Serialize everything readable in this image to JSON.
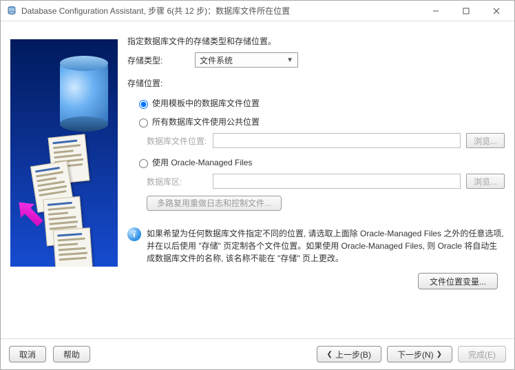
{
  "title": "Database Configuration Assistant, 步骤 6(共 12 步)：数据库文件所在位置",
  "header": "指定数据库文件的存储类型和存储位置。",
  "storage_type_label": "存储类型:",
  "storage_type_value": "文件系统",
  "storage_loc_label": "存储位置:",
  "radios": {
    "template": "使用模板中的数据库文件位置",
    "common": "所有数据库文件使用公共位置",
    "common_field_label": "数据库文件位置:",
    "omf": "使用 Oracle-Managed Files",
    "omf_field_label": "数据库区:"
  },
  "browse_label": "浏览...",
  "multiplex_btn": "多路复用重做日志和控制文件...",
  "info_text": "如果希望为任何数据库文件指定不同的位置, 请选取上面除 Oracle-Managed Files 之外的任意选项, 并在以后使用 \"存储\" 页定制各个文件位置。如果使用 Oracle-Managed Files, 则 Oracle 将自动生成数据库文件的名称, 该名称不能在 \"存储\" 页上更改。",
  "file_loc_var_btn": "文件位置变量...",
  "footer": {
    "cancel": "取消",
    "help": "帮助",
    "back": "上一步(B)",
    "next": "下一步(N)",
    "finish": "完成(E)"
  }
}
